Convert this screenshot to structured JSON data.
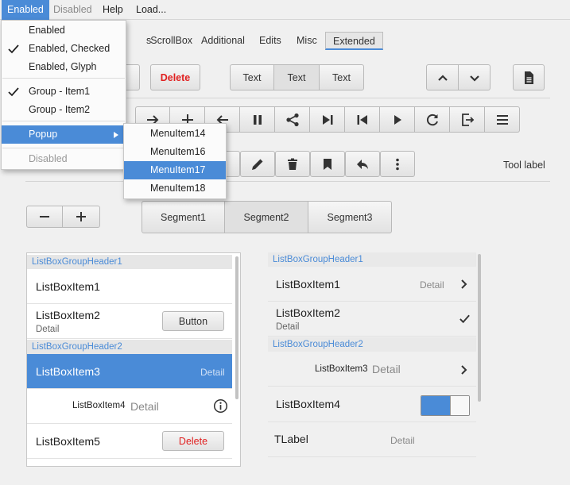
{
  "menubar": {
    "items": [
      "Enabled",
      "Disabled",
      "Help",
      "Load..."
    ]
  },
  "tabs": [
    "s",
    "ScrollBox",
    "Additional",
    "Edits",
    "Misc",
    "Extended"
  ],
  "toolbar1": {
    "delete_label": "Delete",
    "text_segments": [
      "Text",
      "Text",
      "Text"
    ]
  },
  "tool_label": "Tool label",
  "segments": [
    "Segment1",
    "Segment2",
    "Segment3"
  ],
  "enabled_menu": {
    "items": [
      "Enabled",
      "Enabled, Checked",
      "Enabled, Glyph",
      "Group - Item1",
      "Group - Item2",
      "Popup",
      "Disabled"
    ]
  },
  "popup_menu": {
    "items": [
      "MenuItem14",
      "MenuItem16",
      "MenuItem17",
      "MenuItem18"
    ]
  },
  "listbox_left": {
    "header1": "ListBoxGroupHeader1",
    "item1": "ListBoxItem1",
    "item2": "ListBoxItem2",
    "item2_detail": "Detail",
    "item2_button": "Button",
    "header2": "ListBoxGroupHeader2",
    "item3": "ListBoxItem3",
    "item3_detail": "Detail",
    "item4": "ListBoxItem4",
    "item4_detail": "Detail",
    "item5": "ListBoxItem5",
    "item5_button": "Delete"
  },
  "listbox_right": {
    "header1": "ListBoxGroupHeader1",
    "item1": "ListBoxItem1",
    "item1_detail": "Detail",
    "item2": "ListBoxItem2",
    "item2_detail": "Detail",
    "header2": "ListBoxGroupHeader2",
    "item3": "ListBoxItem3",
    "item3_detail": "Detail",
    "item4": "ListBoxItem4",
    "label": "TLabel",
    "label_detail": "Detail"
  },
  "colors": {
    "accent": "#4a8bd7",
    "delete_red": "#e02020"
  }
}
